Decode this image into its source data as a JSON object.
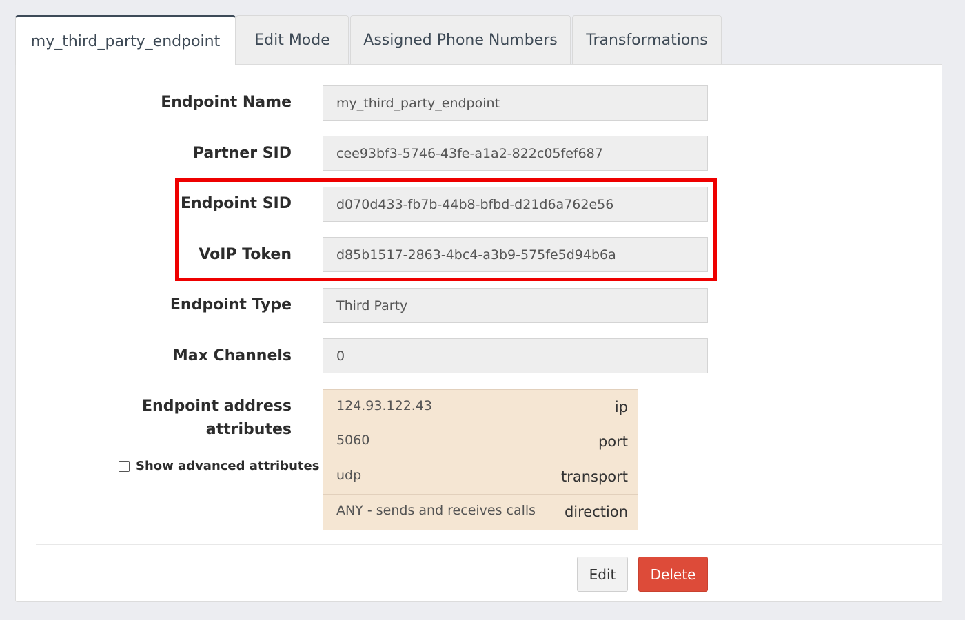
{
  "tabs": [
    {
      "label": "my_third_party_endpoint",
      "active": true
    },
    {
      "label": "Edit Mode"
    },
    {
      "label": "Assigned Phone Numbers"
    },
    {
      "label": "Transformations"
    }
  ],
  "fields": {
    "endpoint_name": {
      "label": "Endpoint Name",
      "value": "my_third_party_endpoint"
    },
    "partner_sid": {
      "label": "Partner SID",
      "value": "cee93bf3-5746-43fe-a1a2-822c05fef687"
    },
    "endpoint_sid": {
      "label": "Endpoint SID",
      "value": "d070d433-fb7b-44b8-bfbd-d21d6a762e56"
    },
    "voip_token": {
      "label": "VoIP Token",
      "value": "d85b1517-2863-4bc4-a3b9-575fe5d94b6a"
    },
    "endpoint_type": {
      "label": "Endpoint Type",
      "value": "Third Party"
    },
    "max_channels": {
      "label": "Max Channels",
      "value": "0"
    }
  },
  "address_attributes": {
    "label_line1": "Endpoint address",
    "label_line2": "attributes",
    "show_advanced_label": "Show advanced attributes",
    "show_advanced_checked": false,
    "rows": [
      {
        "value": "124.93.122.43",
        "key": "ip"
      },
      {
        "value": "5060",
        "key": "port"
      },
      {
        "value": "udp",
        "key": "transport"
      },
      {
        "value": "ANY - sends and receives calls",
        "key": "direction"
      }
    ]
  },
  "actions": {
    "edit_label": "Edit",
    "delete_label": "Delete"
  },
  "colors": {
    "highlight": "#ee0000",
    "delete_button": "#dd4b39",
    "attribute_background": "#f5e6d3",
    "active_tab_accent": "#3d4a58"
  }
}
